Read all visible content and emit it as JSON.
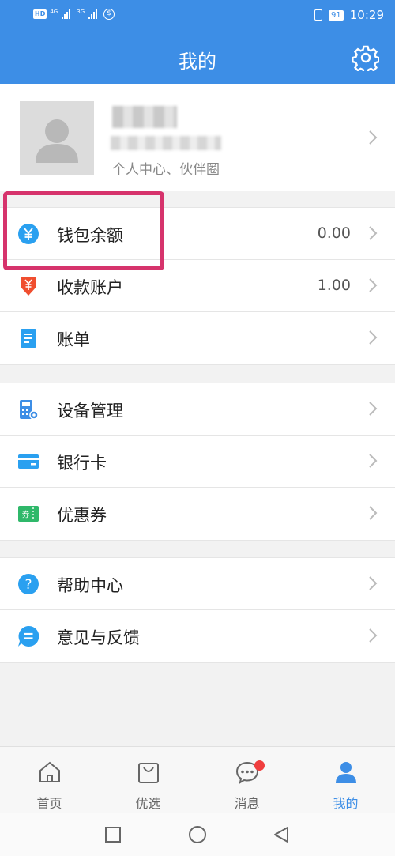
{
  "status_bar": {
    "left_indicators": [
      "HD",
      "4G",
      "3G"
    ],
    "battery": "91",
    "time": "10:29"
  },
  "header": {
    "title": "我的",
    "settings_icon": "gear-icon"
  },
  "profile": {
    "subtitle": "个人中心、伙伴圈"
  },
  "colors": {
    "primary": "#3d8ee6",
    "highlight": "#d6336c",
    "badge": "#f03e3e",
    "coupon_green": "#2fb86a",
    "receive_red": "#f04e2f"
  },
  "menu_groups": [
    [
      {
        "id": "wallet",
        "icon": "yuan-circle-icon",
        "label": "钱包余额",
        "value": "0.00"
      },
      {
        "id": "receive",
        "icon": "receive-account-icon",
        "label": "收款账户",
        "value": "1.00"
      },
      {
        "id": "bill",
        "icon": "bill-icon",
        "label": "账单",
        "value": ""
      }
    ],
    [
      {
        "id": "device",
        "icon": "device-manage-icon",
        "label": "设备管理",
        "value": ""
      },
      {
        "id": "bankcard",
        "icon": "bank-card-icon",
        "label": "银行卡",
        "value": ""
      },
      {
        "id": "coupon",
        "icon": "coupon-icon",
        "label": "优惠券",
        "value": "",
        "icon_text": "券"
      }
    ],
    [
      {
        "id": "help",
        "icon": "help-icon",
        "label": "帮助中心",
        "value": "",
        "icon_text": "?"
      },
      {
        "id": "feedback",
        "icon": "feedback-icon",
        "label": "意见与反馈",
        "value": ""
      }
    ]
  ],
  "tabbar": {
    "tabs": [
      {
        "label": "首页",
        "icon": "home-icon",
        "active": false
      },
      {
        "label": "优选",
        "icon": "shopping-bag-icon",
        "active": false
      },
      {
        "label": "消息",
        "icon": "message-icon",
        "active": false,
        "badge": true
      },
      {
        "label": "我的",
        "icon": "person-icon",
        "active": true
      }
    ]
  }
}
